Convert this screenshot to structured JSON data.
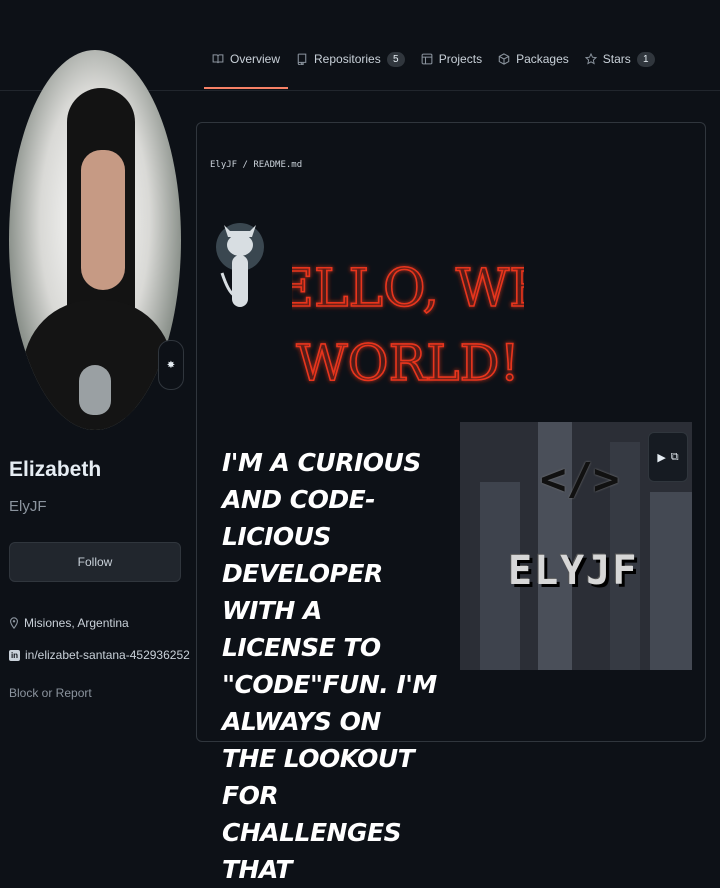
{
  "tabs": [
    {
      "label": "Overview",
      "icon": "book-icon",
      "active": true
    },
    {
      "label": "Repositories",
      "icon": "repo-icon",
      "count": "5"
    },
    {
      "label": "Projects",
      "icon": "project-icon"
    },
    {
      "label": "Packages",
      "icon": "package-icon"
    },
    {
      "label": "Stars",
      "icon": "star-icon",
      "count": "1"
    }
  ],
  "profile": {
    "name": "Elizabeth",
    "login": "ElyJF",
    "follow_label": "Follow",
    "location": "Misiones, Argentina",
    "linkedin": "in/elizabet-santana-452936252",
    "block_label": "Block or Report",
    "status_emoji": "✸"
  },
  "readme": {
    "breadcrumb": "ElyJF / README.md",
    "hello_line1": "HELLO, WEB",
    "hello_line2": "WORLD!",
    "intro": "I'm a curious and code-licious developer with a license to \"code\"fun. I'm always on the lookout for challenges that",
    "video_text": "ELYJF",
    "video_code": "</>"
  },
  "colors": {
    "accent": "#f78166",
    "neon": "#e8351e",
    "bg": "#0d1117",
    "border": "#30363d"
  }
}
